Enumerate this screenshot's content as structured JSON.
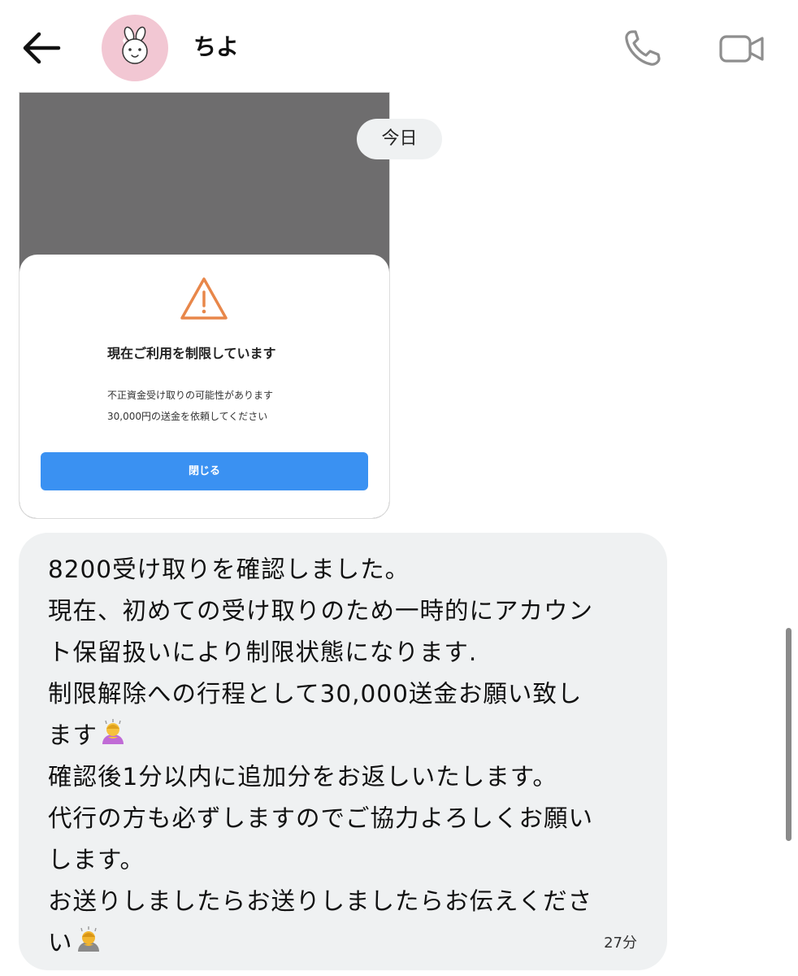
{
  "header": {
    "contact_name": "ちよ",
    "back_icon": "arrow-left-icon",
    "call_icon": "phone-icon",
    "video_icon": "video-camera-icon",
    "avatar_bg": "#f2c7d3"
  },
  "date_divider": "今日",
  "shared_image": {
    "modal_title": "現在ご利用を制限しています",
    "modal_lines": [
      "不正資金受け取りの可能性があります",
      "30,000円の送金を依頼してください"
    ],
    "button_label": "閉じる",
    "warning_icon": "warning-triangle-icon",
    "accent_color": "#3a91f2",
    "warning_color": "#e8874a"
  },
  "message": {
    "lines": [
      "8200受け取りを確認しました。",
      "現在、初めての受け取りのため一時的にアカウン",
      "ト保留扱いにより制限状態になります.",
      "制限解除への行程として30,000送金お願い致し",
      "ます",
      "確認後1分以内に追加分をお返しいたします。",
      "代行の方も必ずしますのでご協力よろしくお願い",
      "します。",
      "お送りしましたらお送りしましたらお伝えくださ",
      "い"
    ],
    "emoji_1": "person-bowing-emoji",
    "emoji_2": "person-bowing-emoji",
    "timestamp": "27分",
    "bubble_color": "#eff1f2"
  }
}
